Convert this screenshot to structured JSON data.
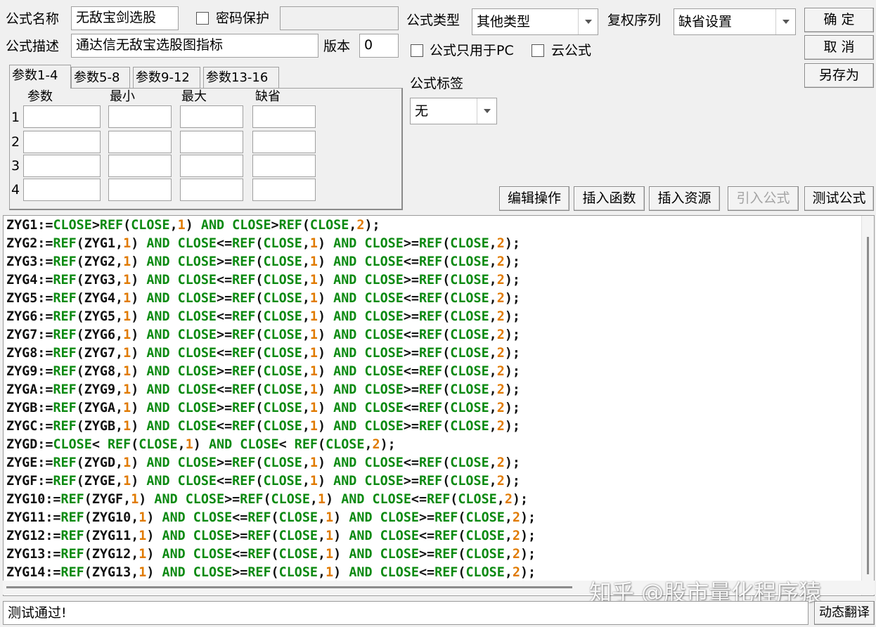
{
  "form": {
    "name_label": "公式名称",
    "name_value": "无敌宝剑选股",
    "password_label": "密码保护",
    "password_value": "",
    "desc_label": "公式描述",
    "desc_value": "通达信无敌宝选股图指标",
    "version_label": "版本",
    "version_value": "0",
    "type_label": "公式类型",
    "type_value": "其他类型",
    "rights_label": "复权序列",
    "rights_value": "缺省设置",
    "pc_only_label": "公式只用于PC",
    "cloud_label": "云公式",
    "tag_label": "公式标签",
    "tag_value": "无"
  },
  "buttons": {
    "ok": "确  定",
    "cancel": "取  消",
    "save_as": "另存为",
    "edit_ops": "编辑操作",
    "insert_func": "插入函数",
    "insert_res": "插入资源",
    "import_formula": "引入公式",
    "test_formula": "测试公式",
    "dynamic_translate": "动态翻译"
  },
  "params": {
    "tabs": [
      "参数1-4",
      "参数5-8",
      "参数9-12",
      "参数13-16"
    ],
    "active_tab": 0,
    "headers": [
      "参数",
      "最小",
      "最大",
      "缺省"
    ],
    "rows": [
      "1",
      "2",
      "3",
      "4"
    ]
  },
  "code_lines": [
    "ZYG1:=CLOSE>REF(CLOSE,1) AND CLOSE>REF(CLOSE,2);",
    "ZYG2:=REF(ZYG1,1) AND CLOSE<=REF(CLOSE,1) AND CLOSE>=REF(CLOSE,2);",
    "ZYG3:=REF(ZYG2,1) AND CLOSE>=REF(CLOSE,1) AND CLOSE<=REF(CLOSE,2);",
    "ZYG4:=REF(ZYG3,1) AND CLOSE<=REF(CLOSE,1) AND CLOSE>=REF(CLOSE,2);",
    "ZYG5:=REF(ZYG4,1) AND CLOSE>=REF(CLOSE,1) AND CLOSE<=REF(CLOSE,2);",
    "ZYG6:=REF(ZYG5,1) AND CLOSE<=REF(CLOSE,1) AND CLOSE>=REF(CLOSE,2);",
    "ZYG7:=REF(ZYG6,1) AND CLOSE>=REF(CLOSE,1) AND CLOSE<=REF(CLOSE,2);",
    "ZYG8:=REF(ZYG7,1) AND CLOSE<=REF(CLOSE,1) AND CLOSE>=REF(CLOSE,2);",
    "ZYG9:=REF(ZYG8,1) AND CLOSE>=REF(CLOSE,1) AND CLOSE<=REF(CLOSE,2);",
    "ZYGA:=REF(ZYG9,1) AND CLOSE<=REF(CLOSE,1) AND CLOSE>=REF(CLOSE,2);",
    "ZYGB:=REF(ZYGA,1) AND CLOSE>=REF(CLOSE,1) AND CLOSE<=REF(CLOSE,2);",
    "ZYGC:=REF(ZYGB,1) AND CLOSE<=REF(CLOSE,1) AND CLOSE>=REF(CLOSE,2);",
    "ZYGD:=CLOSE< REF(CLOSE,1) AND CLOSE< REF(CLOSE,2);",
    "ZYGE:=REF(ZYGD,1) AND CLOSE>=REF(CLOSE,1) AND CLOSE<=REF(CLOSE,2);",
    "ZYGF:=REF(ZYGE,1) AND CLOSE<=REF(CLOSE,1) AND CLOSE>=REF(CLOSE,2);",
    "ZYG10:=REF(ZYGF,1) AND CLOSE>=REF(CLOSE,1) AND CLOSE<=REF(CLOSE,2);",
    "ZYG11:=REF(ZYG10,1) AND CLOSE<=REF(CLOSE,1) AND CLOSE>=REF(CLOSE,2);",
    "ZYG12:=REF(ZYG11,1) AND CLOSE>=REF(CLOSE,1) AND CLOSE<=REF(CLOSE,2);",
    "ZYG13:=REF(ZYG12,1) AND CLOSE<=REF(CLOSE,1) AND CLOSE>=REF(CLOSE,2);",
    "ZYG14:=REF(ZYG13,1) AND CLOSE>=REF(CLOSE,1) AND CLOSE<=REF(CLOSE,2);"
  ],
  "syntax_colors": {
    "identifier": "#111111",
    "keyword": "#0c8a12",
    "number": "#e07a00"
  },
  "status_text": "测试通过!",
  "watermark": "知乎 @股市量化程序猿"
}
